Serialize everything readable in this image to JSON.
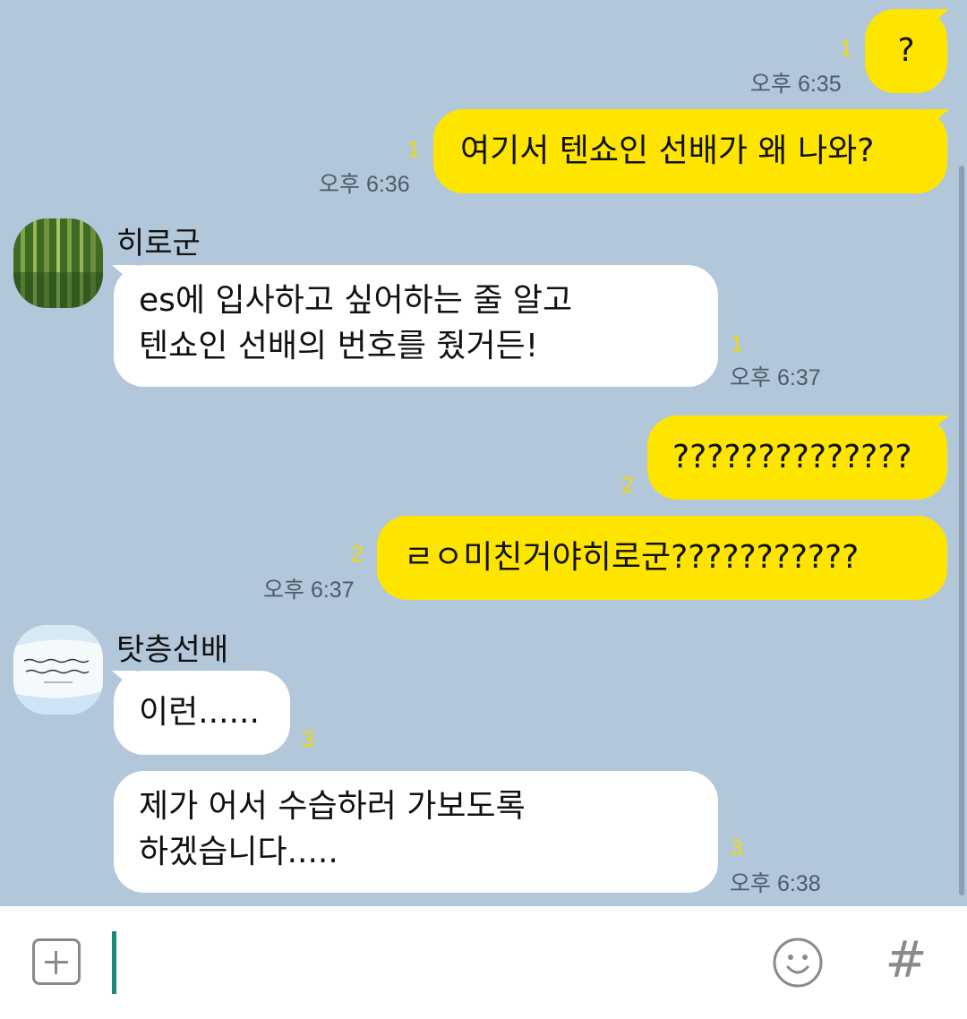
{
  "messages": [
    {
      "from": "me",
      "text": "?",
      "unread": "1",
      "time": "오후 6:35"
    },
    {
      "from": "me",
      "text": "여기서 텐쇼인 선배가 왜 나와?",
      "unread": "1",
      "time": "오후 6:36"
    },
    {
      "from": "히로군",
      "sender": "히로군",
      "line1": "es에 입사하고 싶어하는 줄 알고",
      "line2": "텐쇼인 선배의 번호를 줬거든!",
      "unread": "1",
      "time": "오후 6:37"
    },
    {
      "from": "me",
      "text": "??????????????",
      "unread": "2"
    },
    {
      "from": "me",
      "text": "ㄹㅇ미친거야히로군???????????",
      "unread": "2",
      "time": "오후 6:37"
    },
    {
      "from": "탓층선배",
      "sender": "탓층선배",
      "text": "이런......",
      "unread": "3"
    },
    {
      "from": "탓층선배",
      "line1": "제가 어서 수습하러 가보도록",
      "line2": "하겠습니다.....",
      "unread": "3",
      "time": "오후 6:38"
    }
  ],
  "avatars": {
    "hiro": "bamboo-forest-photo",
    "senpai": "calligraphy-quote-image"
  },
  "input": {
    "value": "",
    "plus_icon": "plus-icon",
    "emoji_icon": "emoji-icon",
    "hash_label": "#"
  },
  "colors": {
    "background": "#b2c7da",
    "my_bubble": "#fee500",
    "their_bubble": "#ffffff",
    "unread": "#f2d90a"
  }
}
